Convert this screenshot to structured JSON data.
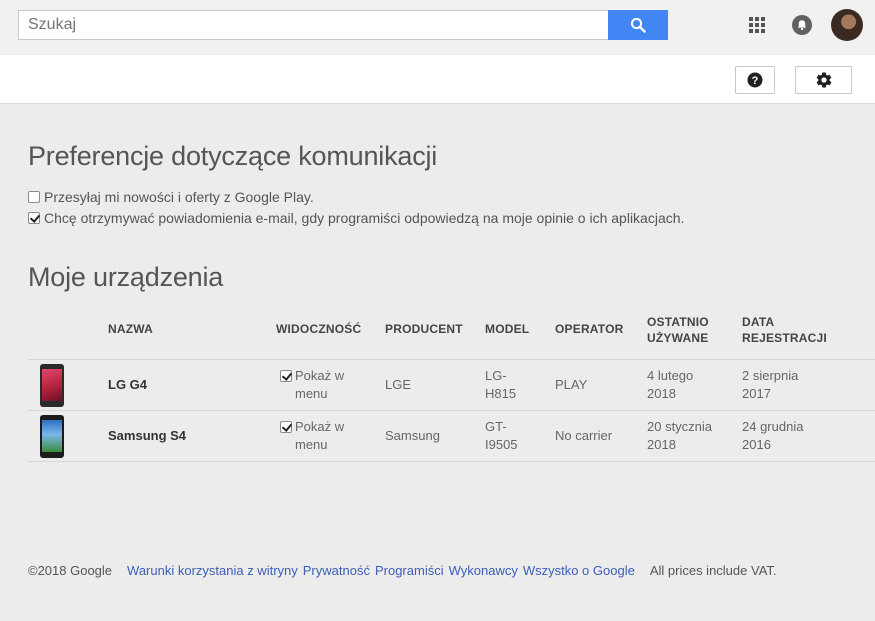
{
  "search": {
    "placeholder": "Szukaj"
  },
  "communication": {
    "title": "Preferencje dotyczące komunikacji",
    "options": [
      {
        "label": "Przesyłaj mi nowości i oferty z Google Play.",
        "checked": false
      },
      {
        "label": "Chcę otrzymywać powiadomienia e-mail, gdy programiści odpowiedzą na moje opinie o ich aplikacjach.",
        "checked": true
      }
    ]
  },
  "devices": {
    "title": "Moje urządzenia",
    "headers": {
      "name": "NAZWA",
      "visibility": "WIDOCZNOŚĆ",
      "manufacturer": "PRODUCENT",
      "model": "MODEL",
      "operator": "OPERATOR",
      "last_used_1": "OSTATNIO",
      "last_used_2": "UŻYWANE",
      "registered_1": "DATA",
      "registered_2": "REJESTRACJI"
    },
    "rows": [
      {
        "name": "LG G4",
        "visibility_1": "Pokaż w",
        "visibility_2": "menu",
        "manufacturer": "LGE",
        "model_1": "LG-",
        "model_2": "H815",
        "operator": "PLAY",
        "last_used_1": "4 lutego",
        "last_used_2": "2018",
        "registered_1": "2 sierpnia",
        "registered_2": "2017",
        "shown": true
      },
      {
        "name": "Samsung S4",
        "visibility_1": "Pokaż w",
        "visibility_2": "menu",
        "manufacturer": "Samsung",
        "model_1": "GT-",
        "model_2": "I9505",
        "operator": "No carrier",
        "last_used_1": "20 stycznia",
        "last_used_2": "2018",
        "registered_1": "24 grudnia",
        "registered_2": "2016",
        "shown": true
      }
    ]
  },
  "footer": {
    "copyright": "©2018 Google",
    "links": [
      "Warunki korzystania z witryny",
      "Prywatność",
      "Programiści",
      "Wykonawcy",
      "Wszystko o Google"
    ],
    "vat": "All prices include VAT."
  },
  "colors": {
    "accent": "#4285f4",
    "link": "#3b5fb5",
    "background": "#ececec"
  },
  "icons": [
    "search-icon",
    "apps-grid-icon",
    "notifications-bell-icon",
    "help-icon",
    "gear-icon"
  ]
}
